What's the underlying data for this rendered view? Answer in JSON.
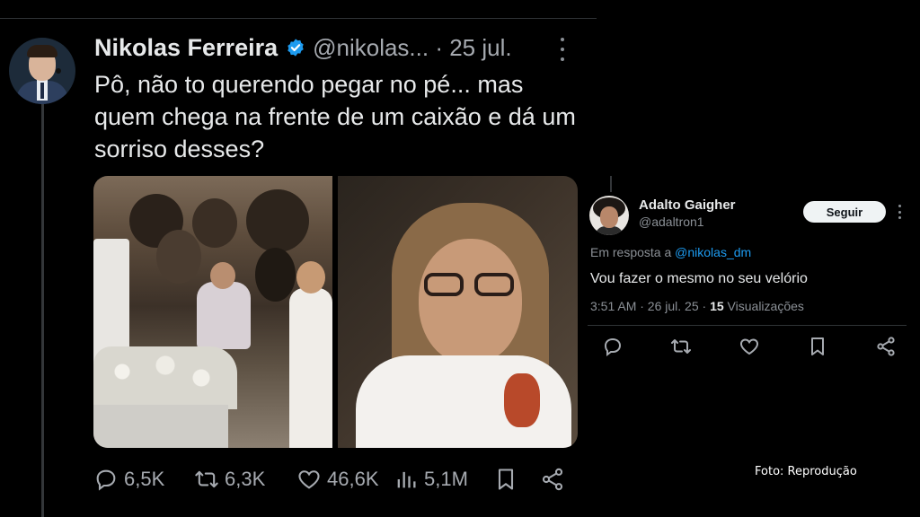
{
  "tweet": {
    "author_name": "Nikolas Ferreira",
    "handle_date": "@nikolas... · 25 jul.",
    "verified_icon": "verified-badge-icon",
    "text": "Pô, não to querendo pegar no pé... mas quem chega na frente de um caixão e dá um sorriso desses?",
    "stats": {
      "replies": "6,5K",
      "reposts": "6,3K",
      "likes": "46,6K",
      "views": "5,1M"
    }
  },
  "reply": {
    "name": "Adalto Gaigher",
    "handle": "@adaltron1",
    "follow_label": "Seguir",
    "in_reply_prefix": "Em resposta a",
    "in_reply_mention": "@nikolas_dm",
    "text": "Vou fazer o mesmo no seu velório",
    "meta_prefix": "3:51 AM · 26 jul. 25 · ",
    "views_count": "15",
    "views_label": " Visualizações"
  },
  "credit": "Foto: Reprodução",
  "colors": {
    "background": "#000000",
    "text": "#e7e9ea",
    "muted": "#a6aab0",
    "accent": "#1d9bf0"
  }
}
